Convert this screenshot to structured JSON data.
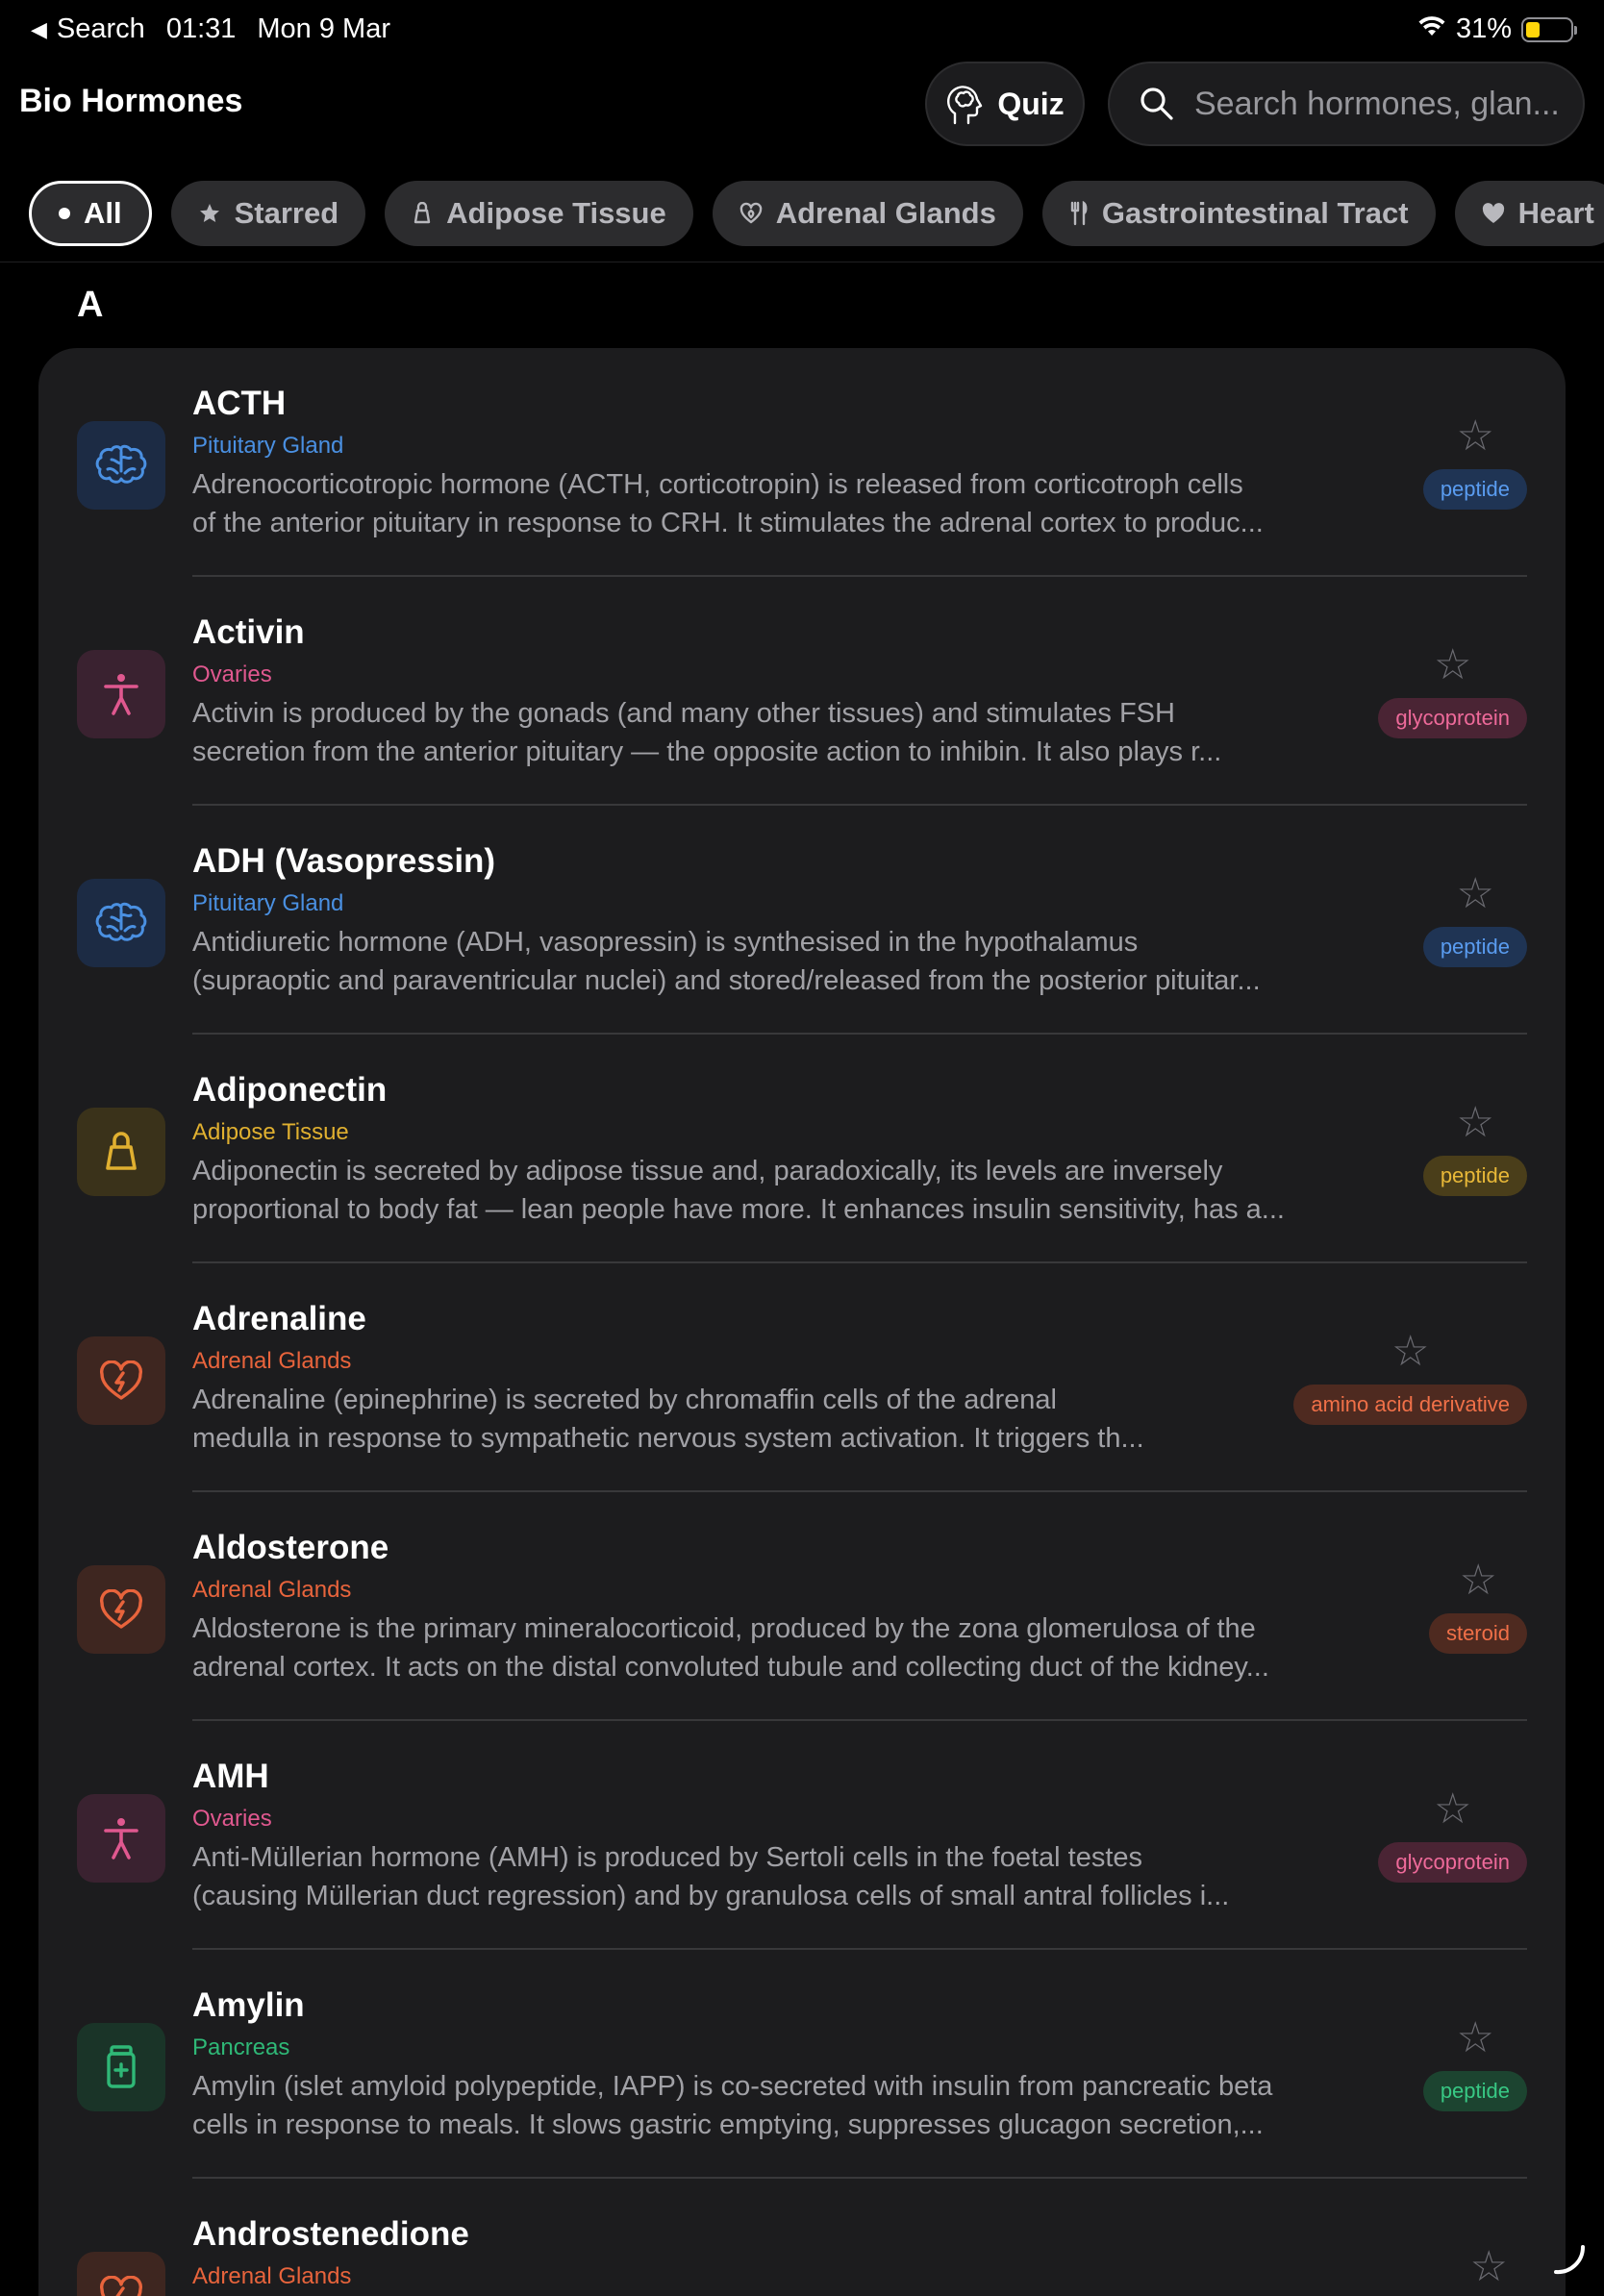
{
  "status": {
    "back_label": "Search",
    "time": "01:31",
    "date": "Mon 9 Mar",
    "battery": "31%",
    "battery_level": 0.31
  },
  "header": {
    "title": "Bio Hormones",
    "quiz_label": "Quiz",
    "search_placeholder": "Search hormones, glan..."
  },
  "filters": [
    {
      "label": "All",
      "icon": "dot-icon",
      "active": true
    },
    {
      "label": "Starred",
      "icon": "star-icon"
    },
    {
      "label": "Adipose Tissue",
      "icon": "kettlebell-icon"
    },
    {
      "label": "Adrenal Glands",
      "icon": "heart-shield-icon"
    },
    {
      "label": "Gastrointestinal Tract",
      "icon": "fork-knife-icon"
    },
    {
      "label": "Heart",
      "icon": "heart-icon"
    }
  ],
  "section": {
    "letter": "A"
  },
  "colors": {
    "pituitary": "#4a90e2",
    "ovaries": "#e0588f",
    "adipose": "#e0b030",
    "adrenal": "#e8643c",
    "pancreas": "#2fb877"
  },
  "hormones": [
    {
      "name": "ACTH",
      "gland": "Pituitary Gland",
      "desc1": "Adrenocorticotropic hormone (ACTH, corticotropin) is released from corticotroph cells",
      "desc2": "of the anterior pituitary in response to CRH. It stimulates the adrenal cortex to produc...",
      "badge": "peptide",
      "theme": "pituitary",
      "icon": "brain-icon"
    },
    {
      "name": "Activin",
      "gland": "Ovaries",
      "desc1": "Activin is produced by the gonads (and many other tissues) and stimulates FSH",
      "desc2": "secretion from the anterior pituitary — the opposite action to inhibin. It also plays r...",
      "badge": "glycoprotein",
      "theme": "ovaries",
      "icon": "person-icon"
    },
    {
      "name": "ADH (Vasopressin)",
      "gland": "Pituitary Gland",
      "desc1": "Antidiuretic hormone (ADH, vasopressin) is synthesised in the hypothalamus",
      "desc2": "(supraoptic and paraventricular nuclei) and stored/released from the posterior pituitar...",
      "badge": "peptide",
      "theme": "pituitary",
      "icon": "brain-icon"
    },
    {
      "name": "Adiponectin",
      "gland": "Adipose Tissue",
      "desc1": "Adiponectin is secreted by adipose tissue and, paradoxically, its levels are inversely",
      "desc2": "proportional to body fat — lean people have more. It enhances insulin sensitivity, has a...",
      "badge": "peptide",
      "theme": "adipose",
      "icon": "kettlebell-icon"
    },
    {
      "name": "Adrenaline",
      "gland": "Adrenal Glands",
      "desc1": "Adrenaline (epinephrine) is secreted by chromaffin cells of the adrenal",
      "desc2": "medulla in response to sympathetic nervous system activation. It triggers th...",
      "badge": "amino acid derivative",
      "theme": "adrenal",
      "icon": "heart-bolt-icon"
    },
    {
      "name": "Aldosterone",
      "gland": "Adrenal Glands",
      "desc1": "Aldosterone is the primary mineralocorticoid, produced by the zona glomerulosa of the",
      "desc2": "adrenal cortex. It acts on the distal convoluted tubule and collecting duct of the kidney...",
      "badge": "steroid",
      "theme": "adrenal",
      "icon": "heart-bolt-icon"
    },
    {
      "name": "AMH",
      "gland": "Ovaries",
      "desc1": "Anti-Müllerian hormone (AMH) is produced by Sertoli cells in the foetal testes",
      "desc2": "(causing Müllerian duct regression) and by granulosa cells of small antral follicles i...",
      "badge": "glycoprotein",
      "theme": "ovaries",
      "icon": "person-icon"
    },
    {
      "name": "Amylin",
      "gland": "Pancreas",
      "desc1": "Amylin (islet amyloid polypeptide, IAPP) is co-secreted with insulin from pancreatic beta",
      "desc2": "cells in response to meals. It slows gastric emptying, suppresses glucagon secretion,...",
      "badge": "peptide",
      "theme": "pancreas",
      "icon": "medicine-bottle-icon"
    },
    {
      "name": "Androstenedione",
      "gland": "Adrenal Glands",
      "desc1": "",
      "desc2": "",
      "badge": "",
      "theme": "adrenal",
      "icon": "heart-bolt-icon"
    }
  ]
}
